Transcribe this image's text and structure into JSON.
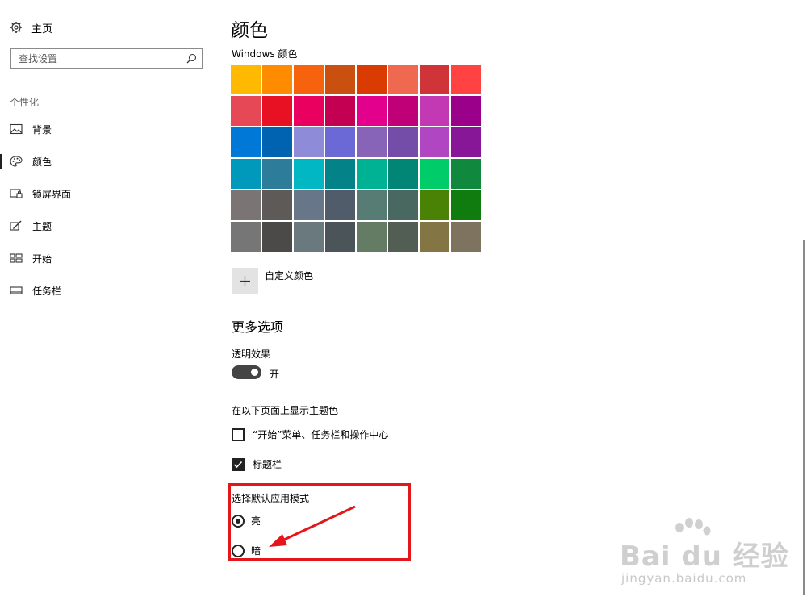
{
  "sidebar": {
    "home_label": "主页",
    "search": {
      "placeholder": "查找设置",
      "value": ""
    },
    "section_heading": "个性化",
    "items": [
      {
        "label": "背景",
        "icon": "picture-icon",
        "active": false
      },
      {
        "label": "颜色",
        "icon": "palette-icon",
        "active": true
      },
      {
        "label": "锁屏界面",
        "icon": "lock-screen-icon",
        "active": false
      },
      {
        "label": "主题",
        "icon": "theme-icon",
        "active": false
      },
      {
        "label": "开始",
        "icon": "start-icon",
        "active": false
      },
      {
        "label": "任务栏",
        "icon": "taskbar-icon",
        "active": false
      }
    ]
  },
  "main": {
    "title": "颜色",
    "windows_colors_label": "Windows 颜色",
    "swatches": [
      "#FFB900",
      "#FF8C00",
      "#F7630C",
      "#CA5010",
      "#DA3B01",
      "#EF6950",
      "#D13438",
      "#FF4343",
      "#E74856",
      "#E81123",
      "#EA005E",
      "#C30052",
      "#E3008C",
      "#BF0077",
      "#C239B3",
      "#9A0089",
      "#0078D7",
      "#0063B1",
      "#8E8CD8",
      "#6B69D6",
      "#8764B8",
      "#744DA9",
      "#B146C2",
      "#881798",
      "#0099BC",
      "#2D7D9A",
      "#00B7C3",
      "#038387",
      "#00B294",
      "#018574",
      "#00CC6A",
      "#10893E",
      "#7A7574",
      "#5D5A58",
      "#68768A",
      "#515C6B",
      "#567C73",
      "#486860",
      "#498205",
      "#107C10",
      "#767676",
      "#4C4A48",
      "#69797E",
      "#4A5459",
      "#647C64",
      "#525E54",
      "#847545",
      "#7E735F"
    ],
    "custom_color_label": "自定义颜色",
    "more_options_heading": "更多选项",
    "transparency": {
      "label": "透明效果",
      "state_label": "开",
      "on": true
    },
    "show_accent_label": "在以下页面上显示主题色",
    "checkboxes": [
      {
        "label": "“开始”菜单、任务栏和操作中心",
        "checked": false
      },
      {
        "label": "标题栏",
        "checked": true
      }
    ],
    "app_mode": {
      "label": "选择默认应用模式",
      "options": [
        {
          "label": "亮",
          "selected": true
        },
        {
          "label": "暗",
          "selected": false
        }
      ]
    }
  },
  "annotation": {
    "highlight_color": "#E5161B"
  },
  "watermark": {
    "main": "Bai du 经验",
    "sub": "jingyan.baidu.com"
  }
}
